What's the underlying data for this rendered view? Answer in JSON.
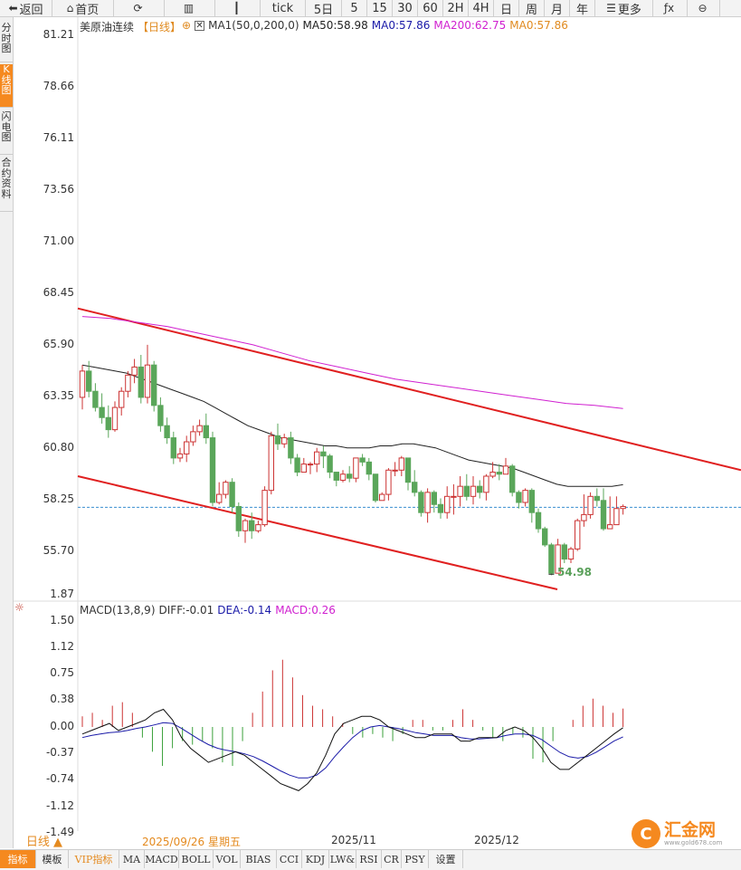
{
  "toolbar": {
    "items": [
      {
        "label": "返回",
        "icon": "back-arrow-icon",
        "glyph": "⬅"
      },
      {
        "label": "首页",
        "icon": "home-icon",
        "glyph": "⌂"
      },
      {
        "label": "",
        "icon": "refresh-icon",
        "glyph": "⟳"
      },
      {
        "label": "",
        "icon": "indicator-chart-icon",
        "glyph": "▥"
      },
      {
        "label": "",
        "icon": "candlestick-icon",
        "glyph": "┃"
      },
      {
        "label": "tick",
        "icon": "",
        "glyph": ""
      },
      {
        "label": "5日",
        "icon": "",
        "glyph": ""
      },
      {
        "label": "5",
        "icon": "",
        "glyph": ""
      },
      {
        "label": "15",
        "icon": "",
        "glyph": ""
      },
      {
        "label": "30",
        "icon": "",
        "glyph": ""
      },
      {
        "label": "60",
        "icon": "",
        "glyph": ""
      },
      {
        "label": "2H",
        "icon": "",
        "glyph": ""
      },
      {
        "label": "4H",
        "icon": "",
        "glyph": ""
      },
      {
        "label": "日",
        "icon": "",
        "glyph": ""
      },
      {
        "label": "周",
        "icon": "",
        "glyph": ""
      },
      {
        "label": "月",
        "icon": "",
        "glyph": ""
      },
      {
        "label": "年",
        "icon": "",
        "glyph": ""
      },
      {
        "label": "更多",
        "icon": "menu-icon",
        "glyph": "☰"
      },
      {
        "label": "",
        "icon": "formula-icon",
        "glyph": "ƒx"
      },
      {
        "label": "",
        "icon": "zoom-out-icon",
        "glyph": "⊖"
      }
    ]
  },
  "sidebar": {
    "tabs": [
      {
        "label": "分时图",
        "active": false
      },
      {
        "label": "K线图",
        "active": true
      },
      {
        "label": "闪电图",
        "active": false
      },
      {
        "label": "合约资料",
        "active": false
      }
    ]
  },
  "legend": {
    "instrument": "美原油连续",
    "period": "【日线】",
    "ma_set": "MA1(50,0,200,0)",
    "ma50": "MA50:58.98",
    "ma0a": "MA0:57.86",
    "ma200": "MA200:62.75",
    "ma0b": "MA0:57.86",
    "colors": {
      "ma50": "#222222",
      "ma0a": "#1a1aa8",
      "ma200": "#d020d0",
      "ma0b": "#e08a1f",
      "instrument": "#333333",
      "period": "#e08a1f"
    }
  },
  "price_axis": [
    "81.21",
    "78.66",
    "76.11",
    "73.56",
    "71.00",
    "68.45",
    "65.90",
    "63.35",
    "60.80",
    "58.25",
    "55.70"
  ],
  "low_label": "54.98",
  "macd_legend": {
    "name": "MACD(13,8,9)",
    "diff": "DIFF:-0.01",
    "dea": "DEA:-0.14",
    "macd": "MACD:0.26"
  },
  "macd_axis": [
    "1.87",
    "1.50",
    "1.12",
    "0.75",
    "0.38",
    "0.00",
    "-0.37",
    "-0.74",
    "-1.12",
    "-1.49"
  ],
  "dates": {
    "cursor": "2025/09/26 星期五",
    "m1": "2025/11",
    "m2": "2025/12"
  },
  "period_button": "日线 ▲",
  "bottom_tabs": [
    "指标",
    "模板",
    "VIP指标",
    "MA",
    "MACD",
    "BOLL",
    "VOL",
    "BIAS",
    "CCI",
    "KDJ",
    "LW&",
    "RSI",
    "CR",
    "PSY",
    "设置"
  ],
  "logo": {
    "glyph": "C",
    "name": "汇金网",
    "url": "www.gold678.com"
  },
  "chart_data": {
    "type": "candlestick",
    "instrument": "美原油连续",
    "period": "日线",
    "ylim": [
      53.8,
      82.0
    ],
    "last_price": 57.86,
    "up_color": "#cc3333",
    "down_color": "#5aa65a",
    "candles": [
      [
        63.3,
        64.6,
        62.7,
        64.9
      ],
      [
        64.6,
        63.6,
        63.3,
        65.1
      ],
      [
        63.6,
        62.8,
        62.6,
        64.0
      ],
      [
        62.8,
        62.3,
        62.0,
        63.5
      ],
      [
        62.3,
        61.7,
        61.3,
        62.9
      ],
      [
        61.7,
        62.8,
        61.6,
        63.1
      ],
      [
        62.8,
        63.6,
        62.4,
        63.8
      ],
      [
        63.6,
        64.4,
        63.3,
        64.6
      ],
      [
        64.4,
        64.8,
        64.0,
        65.2
      ],
      [
        64.8,
        63.3,
        63.0,
        65.4
      ],
      [
        63.3,
        64.9,
        63.0,
        65.9
      ],
      [
        64.9,
        62.9,
        62.6,
        65.1
      ],
      [
        62.9,
        61.9,
        61.6,
        63.3
      ],
      [
        61.9,
        61.3,
        61.0,
        62.3
      ],
      [
        61.3,
        60.3,
        60.0,
        61.6
      ],
      [
        60.3,
        60.5,
        60.1,
        60.8
      ],
      [
        60.5,
        61.1,
        60.1,
        61.4
      ],
      [
        61.1,
        61.6,
        60.9,
        61.9
      ],
      [
        61.6,
        61.9,
        61.4,
        62.2
      ],
      [
        61.9,
        61.3,
        61.0,
        62.5
      ],
      [
        61.3,
        58.1,
        57.9,
        61.6
      ],
      [
        58.1,
        58.5,
        58.0,
        59.1
      ],
      [
        58.5,
        59.1,
        58.3,
        59.2
      ],
      [
        59.1,
        57.9,
        57.6,
        59.3
      ],
      [
        57.9,
        56.7,
        56.4,
        58.1
      ],
      [
        56.7,
        57.2,
        56.1,
        57.3
      ],
      [
        57.2,
        56.7,
        56.3,
        57.6
      ],
      [
        56.7,
        57.0,
        56.6,
        57.2
      ],
      [
        57.0,
        58.7,
        56.9,
        58.9
      ],
      [
        58.7,
        61.4,
        58.5,
        61.6
      ],
      [
        61.4,
        61.0,
        60.7,
        62.0
      ],
      [
        61.0,
        61.3,
        60.8,
        61.5
      ],
      [
        61.3,
        60.3,
        60.0,
        61.6
      ],
      [
        60.3,
        59.6,
        59.4,
        60.5
      ],
      [
        59.6,
        60.0,
        59.6,
        60.3
      ],
      [
        60.0,
        60.0,
        59.5,
        60.1
      ],
      [
        60.0,
        60.6,
        59.6,
        60.8
      ],
      [
        60.6,
        60.4,
        59.8,
        60.9
      ],
      [
        60.4,
        59.6,
        59.3,
        60.5
      ],
      [
        59.6,
        59.2,
        58.9,
        59.6
      ],
      [
        59.2,
        59.5,
        59.1,
        59.7
      ],
      [
        59.5,
        59.3,
        59.1,
        59.9
      ],
      [
        59.3,
        60.3,
        59.1,
        60.3
      ],
      [
        60.3,
        60.1,
        59.9,
        60.5
      ],
      [
        60.1,
        59.5,
        59.2,
        60.3
      ],
      [
        59.5,
        58.2,
        58.1,
        59.5
      ],
      [
        58.2,
        58.5,
        58.2,
        58.6
      ],
      [
        58.5,
        59.7,
        58.2,
        59.8
      ],
      [
        59.7,
        59.7,
        59.4,
        60.1
      ],
      [
        59.7,
        60.3,
        59.4,
        60.4
      ],
      [
        60.3,
        59.1,
        58.7,
        60.3
      ],
      [
        59.1,
        58.6,
        58.4,
        59.7
      ],
      [
        58.6,
        57.6,
        57.4,
        58.7
      ],
      [
        57.6,
        58.6,
        57.1,
        58.8
      ],
      [
        58.6,
        58.0,
        57.6,
        58.7
      ],
      [
        58.0,
        57.6,
        57.3,
        58.3
      ],
      [
        57.6,
        58.4,
        57.3,
        58.9
      ],
      [
        58.4,
        58.4,
        57.5,
        59.0
      ],
      [
        58.4,
        58.9,
        57.9,
        59.4
      ],
      [
        58.9,
        58.4,
        58.2,
        59.5
      ],
      [
        58.4,
        58.9,
        58.0,
        59.4
      ],
      [
        58.9,
        58.6,
        58.3,
        59.2
      ],
      [
        58.6,
        59.4,
        58.2,
        59.5
      ],
      [
        59.4,
        59.6,
        59.3,
        60.1
      ],
      [
        59.6,
        59.5,
        59.2,
        60.0
      ],
      [
        59.5,
        59.9,
        59.5,
        60.3
      ],
      [
        59.9,
        58.6,
        58.4,
        60.0
      ],
      [
        58.6,
        58.1,
        57.8,
        58.7
      ],
      [
        58.1,
        58.7,
        57.9,
        58.8
      ],
      [
        58.7,
        57.6,
        57.1,
        58.8
      ],
      [
        57.6,
        56.8,
        56.6,
        57.8
      ],
      [
        56.8,
        56.0,
        55.9,
        56.9
      ],
      [
        56.0,
        54.6,
        54.5,
        56.1
      ],
      [
        54.6,
        56.0,
        54.6,
        56.3
      ],
      [
        56.0,
        55.3,
        55.1,
        56.1
      ],
      [
        55.3,
        55.8,
        55.1,
        55.9
      ],
      [
        55.8,
        57.2,
        55.7,
        57.3
      ],
      [
        57.2,
        57.5,
        56.9,
        58.5
      ],
      [
        57.5,
        58.4,
        57.3,
        58.6
      ],
      [
        58.4,
        58.2,
        57.9,
        58.8
      ],
      [
        58.2,
        56.8,
        56.7,
        58.8
      ],
      [
        56.8,
        57.0,
        56.8,
        58.4
      ],
      [
        57.0,
        57.8,
        57.0,
        58.4
      ],
      [
        57.8,
        57.9,
        57.5,
        58.0
      ]
    ],
    "ma50": [
      64.9,
      64.8,
      64.7,
      64.6,
      64.5,
      64.3,
      64.1,
      63.9,
      63.7,
      63.5,
      63.3,
      63.1,
      62.8,
      62.5,
      62.2,
      61.9,
      61.7,
      61.5,
      61.3,
      61.2,
      61.1,
      61.0,
      60.9,
      60.9,
      60.8,
      60.8,
      60.8,
      60.9,
      60.9,
      61.0,
      61.0,
      60.9,
      60.8,
      60.6,
      60.4,
      60.2,
      60.1,
      60.0,
      59.9,
      59.8,
      59.6,
      59.4,
      59.2,
      59.0,
      58.9,
      58.9,
      58.9,
      58.9,
      58.9,
      58.98
    ],
    "ma200": [
      67.3,
      67.2,
      67.0,
      66.8,
      66.5,
      66.2,
      65.9,
      65.5,
      65.1,
      64.8,
      64.5,
      64.2,
      64.0,
      63.8,
      63.6,
      63.4,
      63.2,
      63.0,
      62.9,
      62.75
    ],
    "channel": {
      "upper": [
        [
          0,
          67.7
        ],
        [
          1,
          59.7
        ]
      ],
      "lower": [
        [
          0,
          59.4
        ],
        [
          1,
          53.8
        ]
      ]
    },
    "macd": {
      "ylim": [
        -1.87,
        2.06
      ],
      "diff": [
        -0.1,
        -0.05,
        0.0,
        0.05,
        -0.05,
        0.0,
        0.05,
        0.1,
        0.2,
        0.25,
        0.1,
        -0.15,
        -0.3,
        -0.4,
        -0.5,
        -0.45,
        -0.4,
        -0.35,
        -0.4,
        -0.5,
        -0.6,
        -0.7,
        -0.8,
        -0.85,
        -0.9,
        -0.8,
        -0.65,
        -0.4,
        -0.1,
        0.05,
        0.1,
        0.15,
        0.15,
        0.1,
        0.0,
        -0.05,
        -0.1,
        -0.15,
        -0.15,
        -0.1,
        -0.1,
        -0.1,
        -0.2,
        -0.2,
        -0.15,
        -0.15,
        -0.15,
        -0.05,
        0.0,
        -0.05,
        -0.15,
        -0.3,
        -0.5,
        -0.6,
        -0.6,
        -0.5,
        -0.4,
        -0.3,
        -0.2,
        -0.1,
        -0.01
      ],
      "dea": [
        -0.15,
        -0.12,
        -0.1,
        -0.08,
        -0.07,
        -0.05,
        -0.02,
        0.0,
        0.03,
        0.06,
        0.05,
        -0.02,
        -0.1,
        -0.18,
        -0.25,
        -0.3,
        -0.33,
        -0.35,
        -0.38,
        -0.42,
        -0.48,
        -0.55,
        -0.62,
        -0.68,
        -0.72,
        -0.72,
        -0.68,
        -0.58,
        -0.42,
        -0.28,
        -0.15,
        -0.05,
        0.0,
        0.02,
        0.0,
        -0.02,
        -0.05,
        -0.08,
        -0.1,
        -0.12,
        -0.12,
        -0.12,
        -0.15,
        -0.17,
        -0.17,
        -0.16,
        -0.15,
        -0.12,
        -0.1,
        -0.1,
        -0.12,
        -0.18,
        -0.27,
        -0.36,
        -0.42,
        -0.44,
        -0.42,
        -0.36,
        -0.28,
        -0.2,
        -0.14
      ],
      "hist": [
        0.15,
        0.2,
        0.1,
        0.3,
        0.35,
        0.2,
        -0.15,
        -0.35,
        -0.55,
        -0.3,
        -0.2,
        -0.25,
        -0.2,
        -0.3,
        -0.5,
        -0.55,
        -0.2,
        0.2,
        0.5,
        0.8,
        0.95,
        0.7,
        0.45,
        0.3,
        0.25,
        0.15,
        0.05,
        -0.1,
        -0.15,
        -0.1,
        -0.15,
        -0.2,
        -0.1,
        0.1,
        0.1,
        -0.05,
        -0.05,
        0.1,
        0.25,
        0.1,
        -0.05,
        -0.15,
        -0.2,
        -0.1,
        -0.15,
        -0.45,
        -0.5,
        -0.2,
        0.0,
        0.1,
        0.3,
        0.4,
        0.3,
        0.2,
        0.26
      ]
    }
  }
}
